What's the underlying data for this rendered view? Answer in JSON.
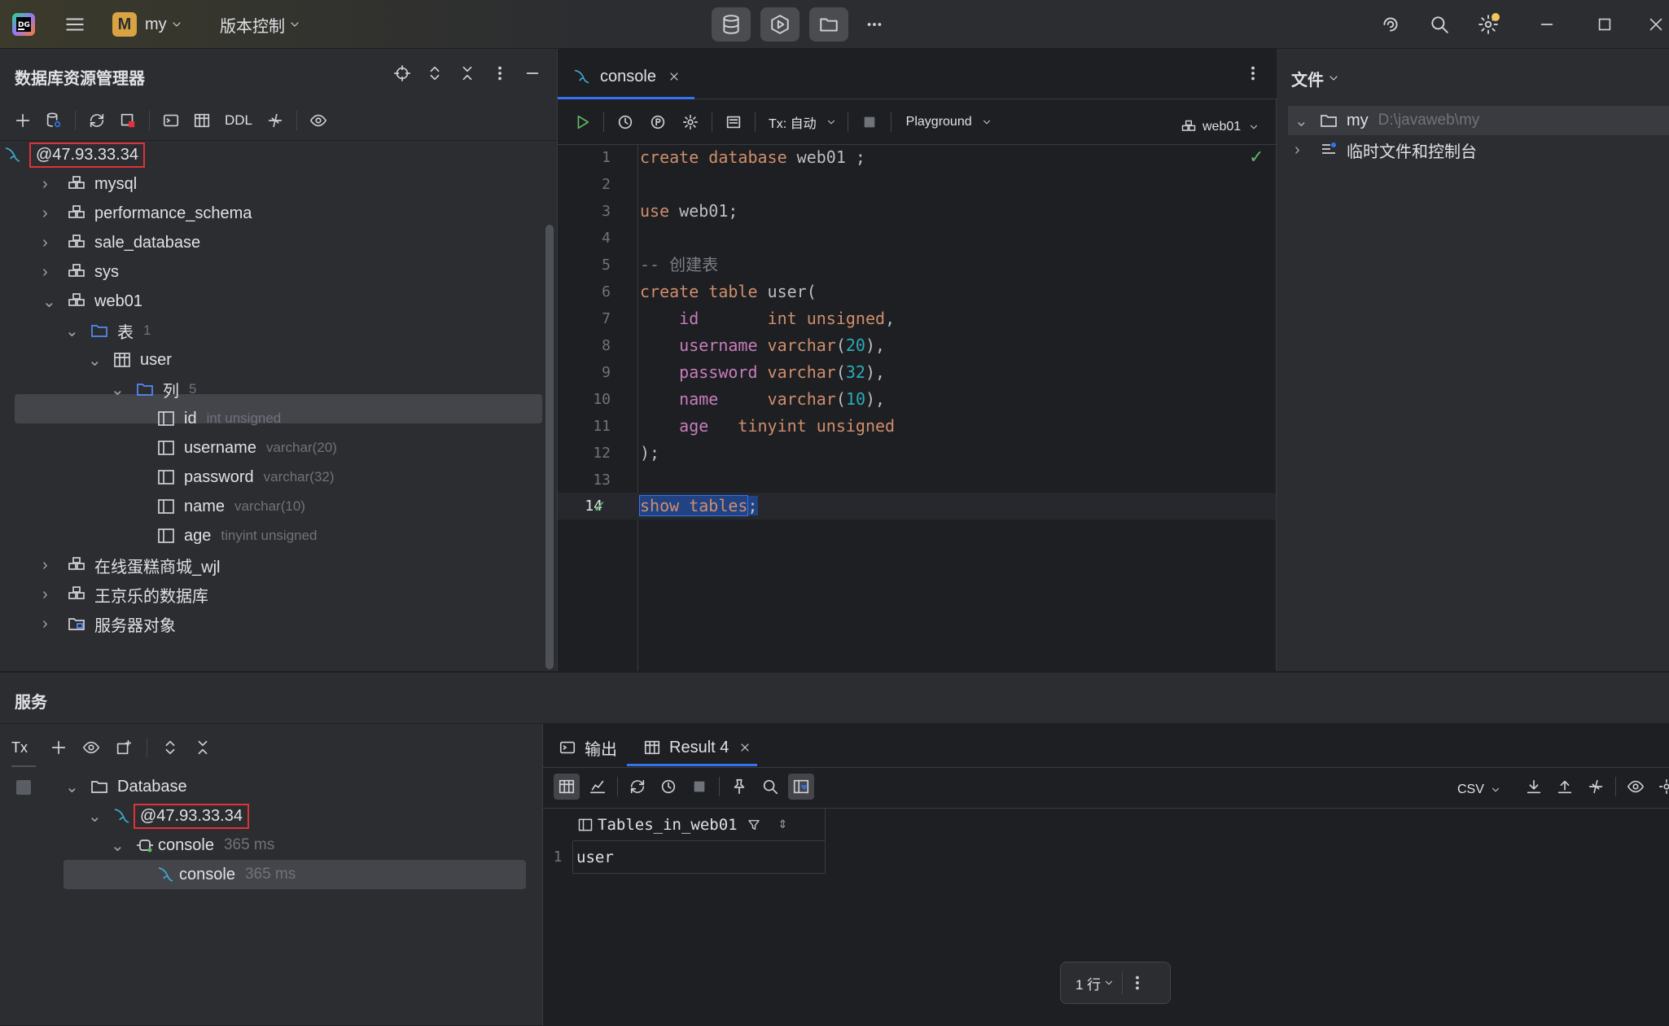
{
  "titlebar": {
    "project_badge": "M",
    "project_name": "my",
    "vcs_label": "版本控制"
  },
  "db_explorer": {
    "title": "数据库资源管理器",
    "toolbar_ddl": "DDL",
    "connection": "@47.93.33.34",
    "tree": [
      {
        "label": "mysql"
      },
      {
        "label": "performance_schema"
      },
      {
        "label": "sale_database"
      },
      {
        "label": "sys"
      },
      {
        "label": "web01"
      },
      {
        "label": "表",
        "count": "1"
      },
      {
        "label": "user"
      },
      {
        "label": "列",
        "count": "5"
      },
      {
        "label": "id",
        "type": "int unsigned"
      },
      {
        "label": "username",
        "type": "varchar(20)"
      },
      {
        "label": "password",
        "type": "varchar(32)"
      },
      {
        "label": "name",
        "type": "varchar(10)"
      },
      {
        "label": "age",
        "type": "tinyint unsigned"
      },
      {
        "label": "在线蛋糕商城_wjl"
      },
      {
        "label": "王京乐的数据库"
      },
      {
        "label": "服务器对象"
      }
    ]
  },
  "editor": {
    "tab_label": "console",
    "tx_label": "Tx: 自动",
    "playground_label": "Playground",
    "schema_label": "web01",
    "line_numbers": [
      "1",
      "2",
      "3",
      "4",
      "5",
      "6",
      "7",
      "8",
      "9",
      "10",
      "11",
      "12",
      "13",
      "14"
    ],
    "code": {
      "l1_kw": "create database",
      "l1_rest": " web01 ;",
      "l3_kw": "use",
      "l3_rest": " web01;",
      "l5": "-- 创建表",
      "l6_kw": "create table",
      "l6_rest": " user(",
      "l7_f": "id",
      "l7_t": "int unsigned",
      "l8_f": "username",
      "l8_t": "varchar",
      "l8_n": "20",
      "l9_f": "password",
      "l9_t": "varchar",
      "l9_n": "32",
      "l10_f": "name",
      "l10_t": "varchar",
      "l10_n": "10",
      "l11_f": "age",
      "l11_t": "tinyint unsigned",
      "l12": ");",
      "l14_kw": "show tables",
      "l14_rest": ";"
    }
  },
  "files_panel": {
    "title": "文件",
    "root_name": "my",
    "root_path": "D:\\javaweb\\my",
    "scratch_label": "临时文件和控制台"
  },
  "services": {
    "title": "服务",
    "tx_label": "Tx",
    "tree": {
      "database": "Database",
      "connection": "@47.93.33.34",
      "console_group": "console",
      "console_group_time": "365 ms",
      "console_item": "console",
      "console_item_time": "365 ms"
    }
  },
  "results": {
    "output_tab": "输出",
    "result_tab": "Result 4",
    "csv_label": "CSV",
    "column_header": "Tables_in_web01",
    "rows": [
      {
        "num": "1",
        "value": "user"
      }
    ],
    "row_count_label": "1 行"
  },
  "colors": {
    "accent": "#3574f0",
    "highlight_box": "#e0323a",
    "success": "#5fb865"
  }
}
